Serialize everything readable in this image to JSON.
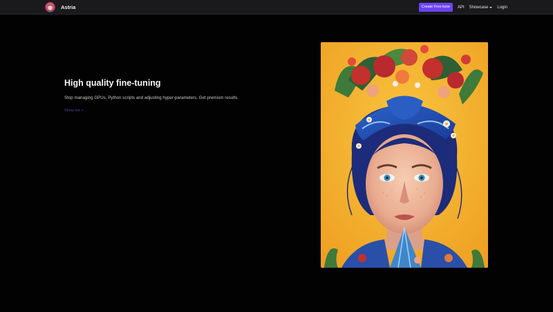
{
  "navbar": {
    "brand_name": "Astria",
    "cta_label": "Create Fine-tune",
    "links": {
      "api": "API",
      "showcase": "Showcase",
      "login": "Login"
    }
  },
  "hero": {
    "title": "High quality fine-tuning",
    "subtitle": "Stop managing GPUs, Python scripts and adjusting hyper-parameters. Get premium results.",
    "link_label": "Show me >"
  },
  "colors": {
    "accent": "#6b44f5",
    "background": "#020203",
    "navbar": "#1a1a1c",
    "portrait_background": "#f4b22a"
  },
  "icons": {
    "logo": "astria-logo",
    "showcase_dropdown": "chevron-down-icon"
  }
}
